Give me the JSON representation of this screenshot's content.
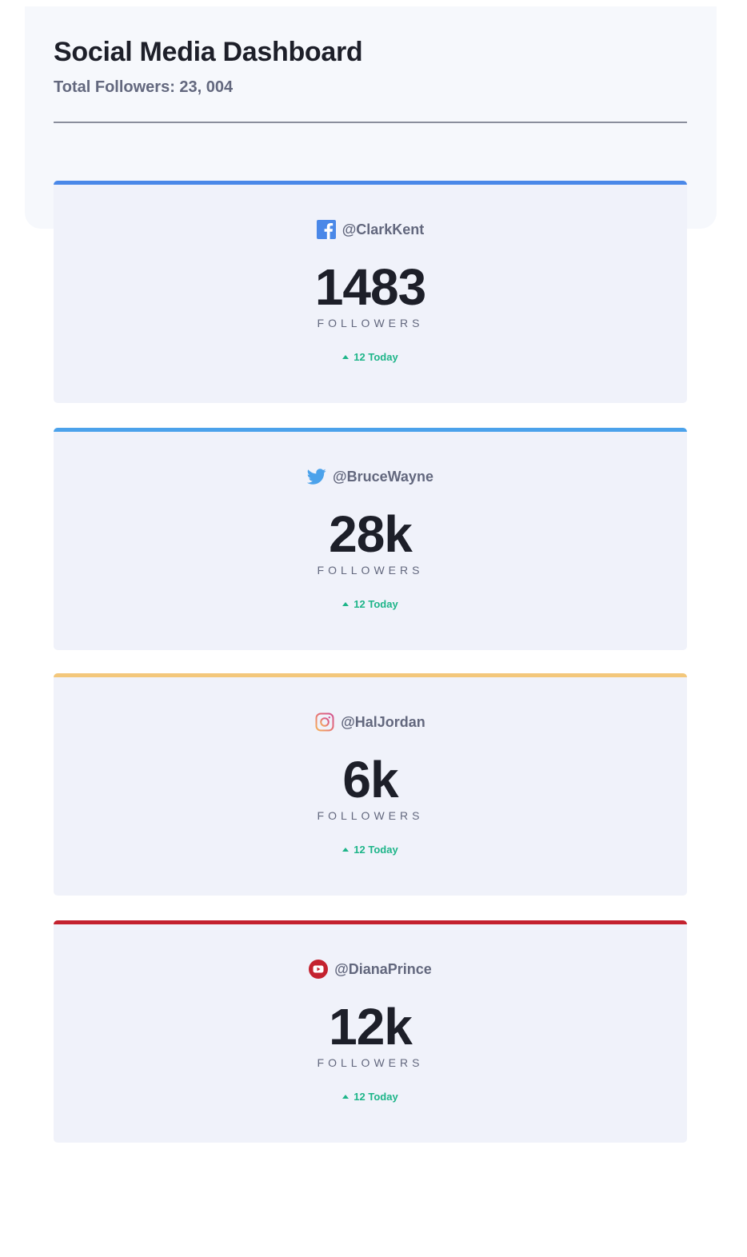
{
  "header": {
    "title": "Social Media Dashboard",
    "total_followers": "Total Followers: 23, 004"
  },
  "cards": [
    {
      "platform": "facebook",
      "icon": "facebook-icon",
      "handle": "@ClarkKent",
      "count": "1483",
      "label": "FOLLOWERS",
      "today": "12 Today",
      "accent": "#4a88e8"
    },
    {
      "platform": "twitter",
      "icon": "twitter-icon",
      "handle": "@BruceWayne",
      "count": "28k",
      "label": "FOLLOWERS",
      "today": "12 Today",
      "accent": "#4ba2eb"
    },
    {
      "platform": "instagram",
      "icon": "instagram-icon",
      "handle": "@HalJordan",
      "count": "6k",
      "label": "FOLLOWERS",
      "today": "12 Today",
      "accent": "#f3c77b"
    },
    {
      "platform": "youtube",
      "icon": "youtube-icon",
      "handle": "@DianaPrince",
      "count": "12k",
      "label": "FOLLOWERS",
      "today": "12 Today",
      "accent": "#c4222f"
    }
  ],
  "colors": {
    "positive": "#1eb589",
    "text_dark": "#1d1f29",
    "text_muted": "#63687e",
    "card_bg": "#f0f2fa"
  }
}
